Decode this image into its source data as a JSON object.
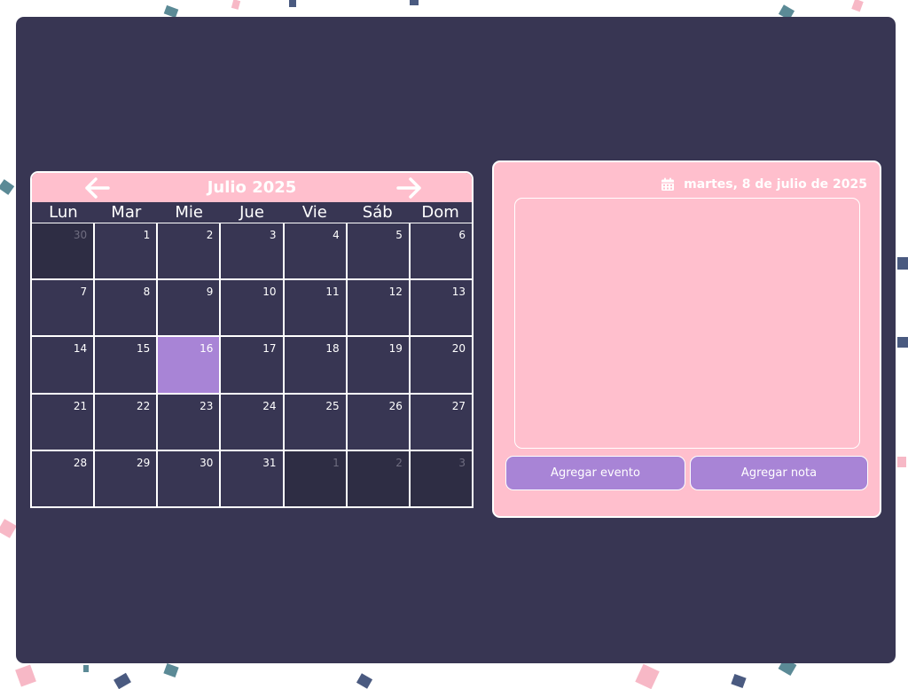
{
  "calendar": {
    "title": "Julio 2025",
    "weekdays": [
      "Lun",
      "Mar",
      "Mie",
      "Jue",
      "Vie",
      "Sáb",
      "Dom"
    ],
    "days": [
      {
        "n": "30",
        "other": true
      },
      {
        "n": "1"
      },
      {
        "n": "2"
      },
      {
        "n": "3"
      },
      {
        "n": "4"
      },
      {
        "n": "5"
      },
      {
        "n": "6"
      },
      {
        "n": "7"
      },
      {
        "n": "8"
      },
      {
        "n": "9"
      },
      {
        "n": "10"
      },
      {
        "n": "11"
      },
      {
        "n": "12"
      },
      {
        "n": "13"
      },
      {
        "n": "14"
      },
      {
        "n": "15"
      },
      {
        "n": "16",
        "today": true
      },
      {
        "n": "17"
      },
      {
        "n": "18"
      },
      {
        "n": "19"
      },
      {
        "n": "20"
      },
      {
        "n": "21"
      },
      {
        "n": "22"
      },
      {
        "n": "23"
      },
      {
        "n": "24"
      },
      {
        "n": "25"
      },
      {
        "n": "26"
      },
      {
        "n": "27"
      },
      {
        "n": "28"
      },
      {
        "n": "29"
      },
      {
        "n": "30"
      },
      {
        "n": "31"
      },
      {
        "n": "1",
        "other": true
      },
      {
        "n": "2",
        "other": true
      },
      {
        "n": "3",
        "other": true
      }
    ],
    "prev_icon": "arrow-left-icon",
    "next_icon": "arrow-right-icon"
  },
  "notes": {
    "selected_date": "martes, 8 de julio de 2025",
    "date_icon": "calendar-icon",
    "note_value": "",
    "add_event_label": "Agregar evento",
    "add_note_label": "Agregar nota"
  },
  "colors": {
    "panel": "#383653",
    "pink": "#ffbfcd",
    "purple": "#a884d6",
    "other_month": "#2e2d44"
  }
}
